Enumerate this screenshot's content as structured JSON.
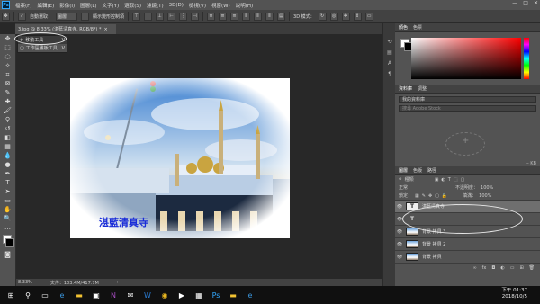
{
  "app": {
    "logo": "Ps"
  },
  "menus": [
    "檔案(F)",
    "編輯(E)",
    "影像(I)",
    "圖層(L)",
    "文字(Y)",
    "選取(S)",
    "濾鏡(T)",
    "3D(D)",
    "檢視(V)",
    "視窗(W)",
    "說明(H)"
  ],
  "window_controls": {
    "minimize": "—",
    "restore": "□",
    "close": "✕"
  },
  "options_bar": {
    "auto_select_label": "自動選取：",
    "auto_select_value": "圖層",
    "transform_controls_label": "顯示變形控制項",
    "mode_3d_label": "3D 模式："
  },
  "document_tab": {
    "title": "3.jpg @ 8.33% (湛藍清真寺, RGB/8*) *",
    "close": "×"
  },
  "flyout": {
    "items": [
      {
        "key": "V",
        "label": "移動工具"
      },
      {
        "key": "V",
        "label": "工作區畫板工具"
      }
    ]
  },
  "canvas": {
    "overlay_text": "湛藍清真寺",
    "overlay_text_color": "#1a2dd8"
  },
  "status_bar": {
    "zoom": "8.33%",
    "doc_size": "文件：103.4M/417.7M"
  },
  "color_panel": {
    "tabs": [
      "顏色",
      "色票"
    ]
  },
  "libraries_panel": {
    "tabs": [
      "資料庫",
      "調整"
    ],
    "library_select": "我的資料庫",
    "search_placeholder": "搜尋 Adobe Stock",
    "size_label": "-- KB"
  },
  "layers_panel": {
    "tabs": [
      "圖層",
      "色版",
      "路徑"
    ],
    "kind_filter": "種類",
    "blend_mode": "正常",
    "opacity_label": "不透明度：",
    "opacity_value": "100%",
    "lock_label": "鎖定：",
    "fill_label": "填滿：",
    "fill_value": "100%",
    "layers": [
      {
        "name": "湛藍清真寺",
        "kind": "text",
        "selected": true
      },
      {
        "name": "",
        "kind": "text",
        "selected": false
      },
      {
        "name": "背景 拷貝 3",
        "kind": "image",
        "selected": false
      },
      {
        "name": "背景 拷貝 2",
        "kind": "image",
        "selected": false
      },
      {
        "name": "背景 拷貝",
        "kind": "image",
        "selected": false
      }
    ]
  },
  "taskbar": {
    "apps": [
      "start-icon",
      "search-icon",
      "task-view-icon",
      "edge-icon",
      "explorer-icon",
      "store-icon",
      "onenote-icon",
      "mail-icon",
      "word-icon",
      "chrome-icon",
      "media-icon",
      "app-icon",
      "photoshop-icon",
      "folder-icon",
      "ie-icon"
    ],
    "time": "下午 01:37",
    "date": "2018/10/5"
  }
}
